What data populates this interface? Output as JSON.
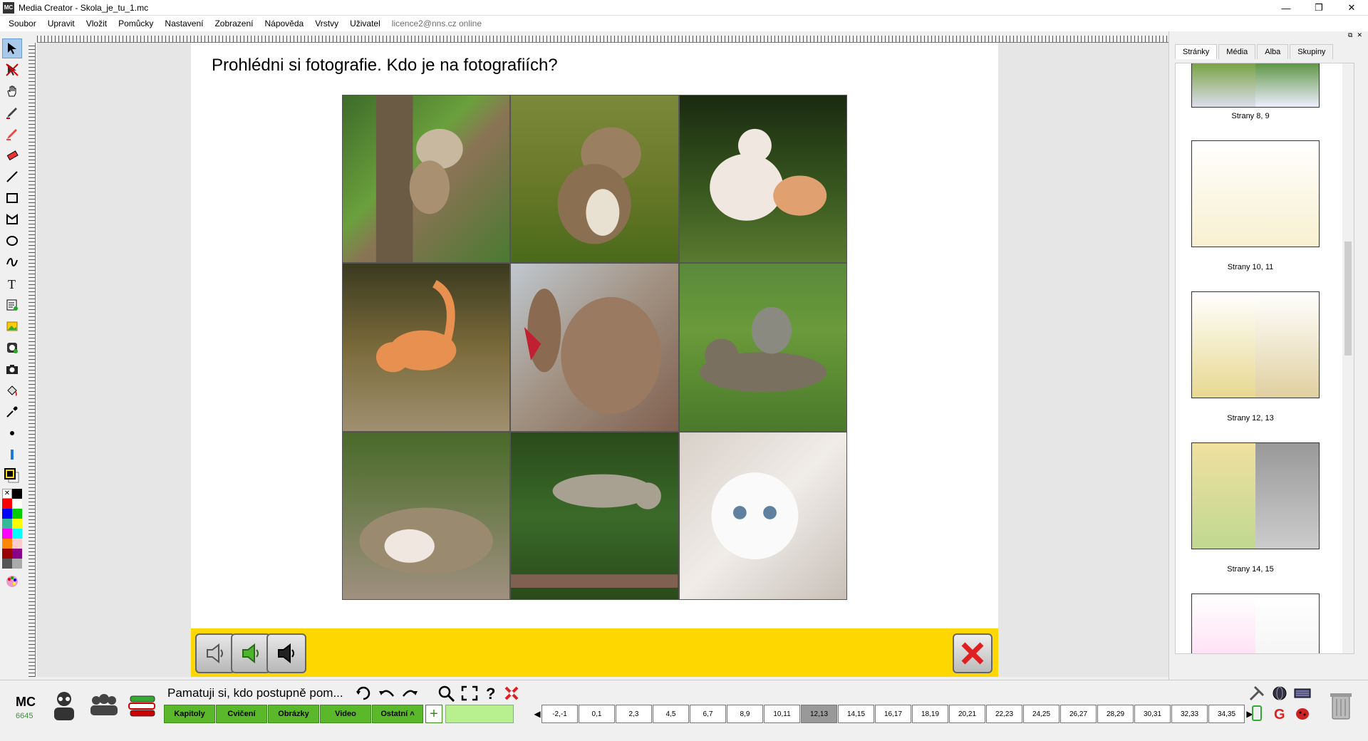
{
  "window": {
    "title": "Media Creator - Skola_je_tu_1.mc",
    "app_icon": "MC"
  },
  "menu": {
    "items": [
      "Soubor",
      "Upravit",
      "Vložit",
      "Pomůcky",
      "Nastavení",
      "Zobrazení",
      "Nápověda",
      "Vrstvy",
      "Uživatel"
    ],
    "status": "licence2@nns.cz online"
  },
  "page": {
    "heading": "Prohlédni si fotografie. Kdo je na fotografiích?",
    "photos": [
      "kitten-in-tree",
      "cat-in-grass",
      "kittens-playing",
      "orange-kitten-running",
      "cat-licking-paw",
      "cats-on-grass",
      "sleeping-cat",
      "cat-jumping",
      "white-kitten"
    ]
  },
  "side_panel": {
    "tabs": [
      "Stránky",
      "Média",
      "Alba",
      "Skupiny"
    ],
    "active_tab": "Stránky",
    "thumbnails": [
      "Strany 8, 9",
      "Strany 10, 11",
      "Strany 12, 13",
      "Strany 14, 15"
    ]
  },
  "bottom": {
    "logo": "MC",
    "counter": "6645",
    "prompt": "Pamatuji si, kdo postupně pom...",
    "nav_buttons": [
      "Kapitoly",
      "Cvičení",
      "Obrázky",
      "Video",
      "Ostatní ˄"
    ],
    "pages": [
      "-2,-1",
      "0,1",
      "2,3",
      "4,5",
      "6,7",
      "8,9",
      "10,11",
      "12,13",
      "14,15",
      "16,17",
      "18,19",
      "20,21",
      "22,23",
      "24,25",
      "26,27",
      "28,29",
      "30,31",
      "32,33",
      "34,35"
    ],
    "current_page": "12,13"
  },
  "colors": {
    "accent_yellow": "#ffd700",
    "nav_green": "#5ab82a",
    "current_page_bg": "#999999"
  }
}
